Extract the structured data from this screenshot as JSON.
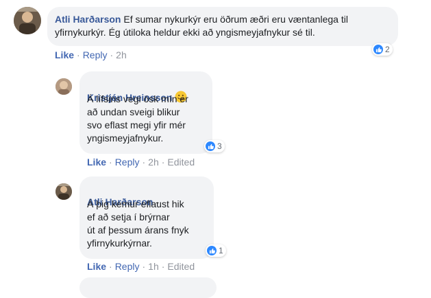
{
  "comments": [
    {
      "author": "Atli Harðarson",
      "text": "Ef sumar nykurkýr eru öðrum æðri eru væntanlega til yfirnykurkýr. Ég útiloka heldur ekki að yngismeyjafnykur sé til.",
      "reaction_count": "2",
      "actions": {
        "like": "Like",
        "reply": "Reply",
        "time": "2h",
        "edited": ""
      }
    },
    {
      "author": "Kristján Hreinsson",
      "author_emoji": "smiling-face-emoji",
      "text": "Á lífsins vegi ósk mín er\nað undan sveigi blikur\nsvo eflast megi yfir mér\nyngismeyjafnykur.",
      "reaction_count": "3",
      "actions": {
        "like": "Like",
        "reply": "Reply",
        "time": "2h",
        "edited": "Edited"
      }
    },
    {
      "author": "Atli Harðarson",
      "author_suffix": " -",
      "text": "Á þig kemur eflaust hik\nef að setja í brýrnar\nút af þessum árans fnyk\nyfirnykurkýrnar.",
      "reaction_count": "1",
      "actions": {
        "like": "Like",
        "reply": "Reply",
        "time": "1h",
        "edited": "Edited"
      }
    }
  ],
  "separator": "·",
  "colors": {
    "bubble": "#f2f3f5",
    "author": "#385898",
    "action_link": "#4267b2",
    "meta": "#90949c",
    "like_reaction": "#2d88ff"
  },
  "icons": {
    "reaction": "thumbs-up-icon"
  }
}
